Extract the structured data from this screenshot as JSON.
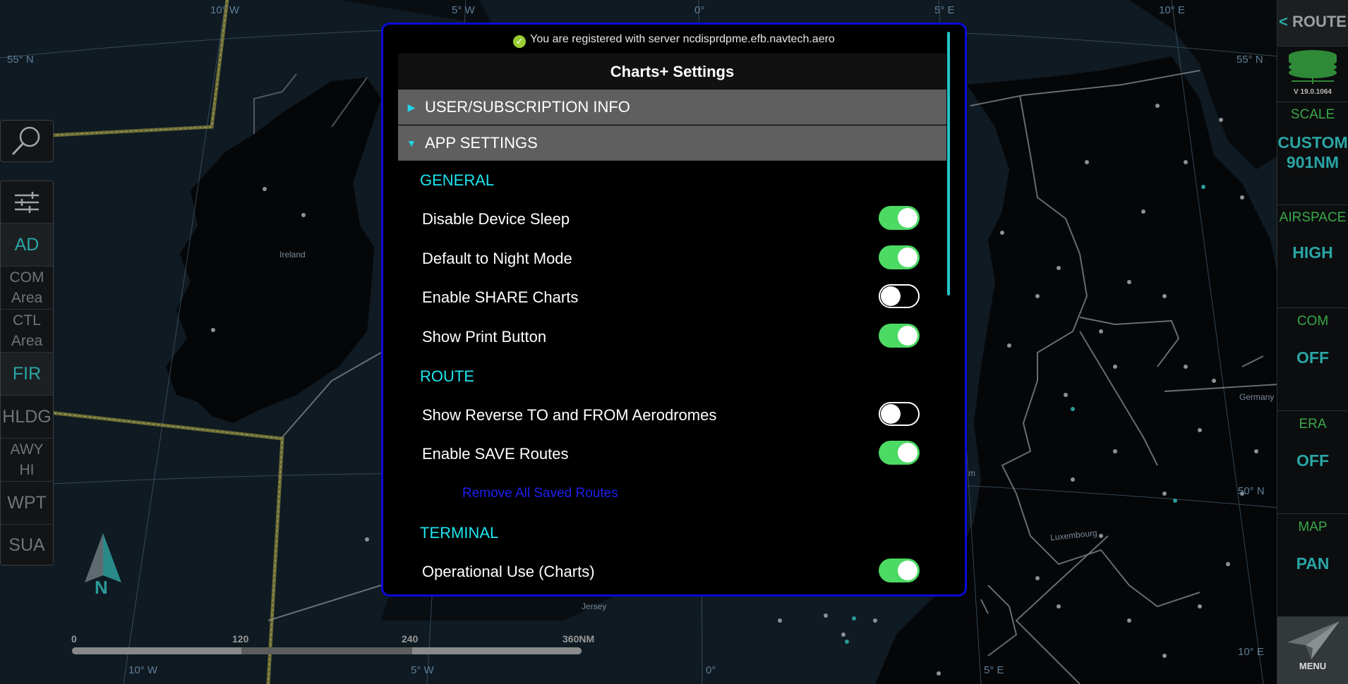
{
  "map": {
    "lon_labels_top": [
      "10° W",
      "5° W",
      "0°",
      "5° E",
      "10° E"
    ],
    "lon_labels_bottom": [
      "10° W",
      "5° W",
      "0°",
      "5° E",
      "10° E"
    ],
    "lat_labels": [
      "55° N",
      "55° N",
      "50° N"
    ],
    "places": [
      "Ireland",
      "Jersey",
      "Luxembourg",
      "Germany",
      "m"
    ]
  },
  "scale_bar": {
    "ticks": [
      "0",
      "120",
      "240",
      "360NM"
    ]
  },
  "left_toolbar": {
    "buttons": [
      {
        "label": "AD",
        "line2": ""
      },
      {
        "label": "COM",
        "line2": "Area"
      },
      {
        "label": "CTL",
        "line2": "Area"
      },
      {
        "label": "FIR",
        "line2": ""
      },
      {
        "label": "HLDG",
        "line2": ""
      },
      {
        "label": "AWY",
        "line2": "HI"
      },
      {
        "label": "WPT",
        "line2": ""
      },
      {
        "label": "SUA",
        "line2": ""
      }
    ],
    "compass_label": "N"
  },
  "right_panel": {
    "route_label": "ROUTE",
    "route_chevron": "<",
    "version": "V 19.0.1064",
    "scale": {
      "label": "SCALE",
      "value1": "CUSTOM",
      "value2": "901NM"
    },
    "airspace": {
      "label": "AIRSPACE",
      "value": "HIGH"
    },
    "com": {
      "label": "COM",
      "value": "OFF"
    },
    "era": {
      "label": "ERA",
      "value": "OFF"
    },
    "map": {
      "label": "MAP",
      "value": "PAN"
    },
    "menu_label": "MENU"
  },
  "dialog": {
    "status": "You are registered with server ncdisprdpme.efb.navtech.aero",
    "title": "Charts+ Settings",
    "sections": [
      {
        "label": "USER/SUBSCRIPTION INFO",
        "expanded": false
      },
      {
        "label": "APP SETTINGS",
        "expanded": true
      }
    ],
    "groups": {
      "general": "GENERAL",
      "route": "ROUTE",
      "terminal": "TERMINAL"
    },
    "settings": {
      "disable_sleep": {
        "label": "Disable Device Sleep",
        "on": true
      },
      "night_mode": {
        "label": "Default to Night Mode",
        "on": true
      },
      "share_charts": {
        "label": "Enable SHARE Charts",
        "on": false
      },
      "print_button": {
        "label": "Show Print Button",
        "on": true
      },
      "reverse_to_from": {
        "label": "Show Reverse TO and FROM Aerodromes",
        "on": false
      },
      "save_routes": {
        "label": "Enable SAVE Routes",
        "on": true
      },
      "operational_use": {
        "label": "Operational Use (Charts)",
        "on": true
      }
    },
    "remove_routes_link": "Remove All Saved Routes"
  },
  "colors": {
    "toggle_on": "#4cd964",
    "group_heading": "#1ee5f0",
    "dialog_border": "#0a0ad8",
    "link": "#1f1ff0",
    "right_label": "#3ba84b",
    "right_value": "#2aa5a5"
  }
}
